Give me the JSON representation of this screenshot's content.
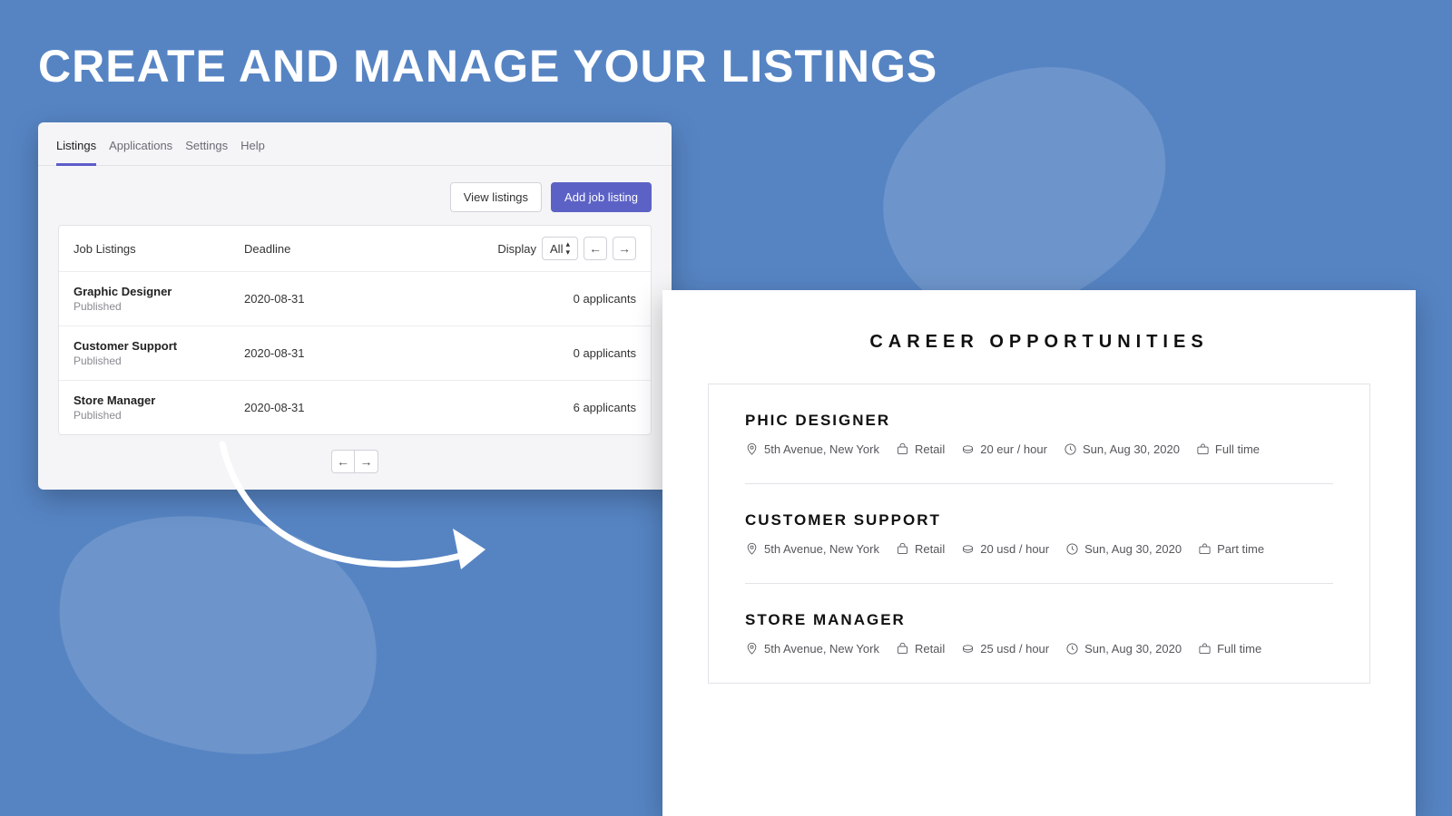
{
  "hero": {
    "title": "CREATE AND MANAGE YOUR LISTINGS"
  },
  "admin": {
    "tabs": [
      "Listings",
      "Applications",
      "Settings",
      "Help"
    ],
    "active_tab_index": 0,
    "buttons": {
      "view": "View listings",
      "add": "Add job listing"
    },
    "columns": {
      "c1": "Job Listings",
      "c2": "Deadline",
      "display_label": "Display",
      "filter_value": "All"
    },
    "rows": [
      {
        "title": "Graphic Designer",
        "status": "Published",
        "deadline": "2020-08-31",
        "applicants": "0 applicants"
      },
      {
        "title": "Customer Support",
        "status": "Published",
        "deadline": "2020-08-31",
        "applicants": "0 applicants"
      },
      {
        "title": "Store Manager",
        "status": "Published",
        "deadline": "2020-08-31",
        "applicants": "6 applicants"
      }
    ]
  },
  "careers": {
    "title": "CAREER OPPORTUNITIES",
    "jobs": [
      {
        "title": "PHIC DESIGNER",
        "location": "5th Avenue, New York",
        "category": "Retail",
        "rate": "20 eur / hour",
        "date": "Sun, Aug 30, 2020",
        "type": "Full time"
      },
      {
        "title": "CUSTOMER SUPPORT",
        "location": "5th Avenue, New York",
        "category": "Retail",
        "rate": "20 usd / hour",
        "date": "Sun, Aug 30, 2020",
        "type": "Part time"
      },
      {
        "title": "STORE MANAGER",
        "location": "5th Avenue, New York",
        "category": "Retail",
        "rate": "25 usd / hour",
        "date": "Sun, Aug 30, 2020",
        "type": "Full time"
      }
    ]
  }
}
